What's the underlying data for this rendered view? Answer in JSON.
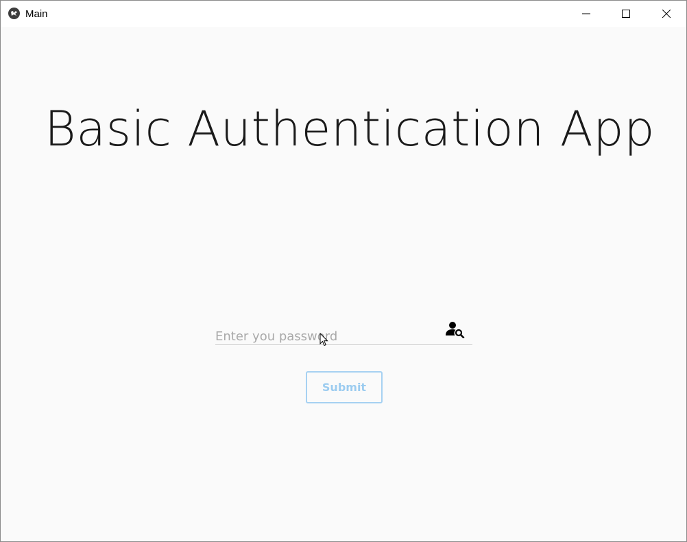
{
  "window": {
    "title": "Main",
    "app_icon": "kivy-logo-icon",
    "controls": [
      "minimize-icon",
      "maximize-icon",
      "close-icon"
    ]
  },
  "main": {
    "heading": "Basic Authentication App",
    "password_field": {
      "placeholder": "Enter you password",
      "value": "",
      "icon": "account-search-icon"
    },
    "submit_label": "Submit"
  },
  "colors": {
    "background": "#fafafa",
    "heading_text": "#1a1a1a",
    "placeholder_text": "#a9a9a9",
    "submit_accent": "#a6d1f2"
  }
}
